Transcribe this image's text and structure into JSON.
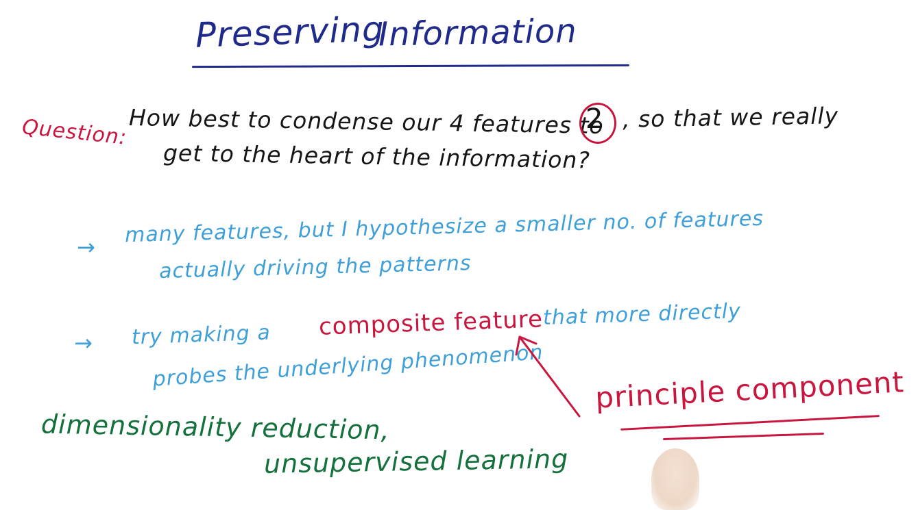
{
  "title": {
    "word1": "Preserving",
    "word2": "Information"
  },
  "question": {
    "label": "Question:",
    "line1_a": "How best to condense our 4 features to",
    "number": "2",
    "line1_b": ", so that we really",
    "line2": "get to the heart of the information?"
  },
  "bullet1": {
    "arrow": "→",
    "line1": "many features, but I hypothesize a smaller no. of features",
    "line2": "actually driving the patterns"
  },
  "bullet2": {
    "arrow": "→",
    "text_a": "try making a",
    "highlight": "composite feature",
    "text_b": "that more directly",
    "line2": "probes the underlying phenomenon"
  },
  "principle": {
    "label": "principle component"
  },
  "terms": {
    "line1": "dimensionality reduction,",
    "line2": "unsupervised learning"
  },
  "colors": {
    "title": "#1f2a8a",
    "question_label": "#c8163f",
    "bullets": "#3f9fd8",
    "highlight": "#c8163f",
    "terms": "#14703c"
  }
}
